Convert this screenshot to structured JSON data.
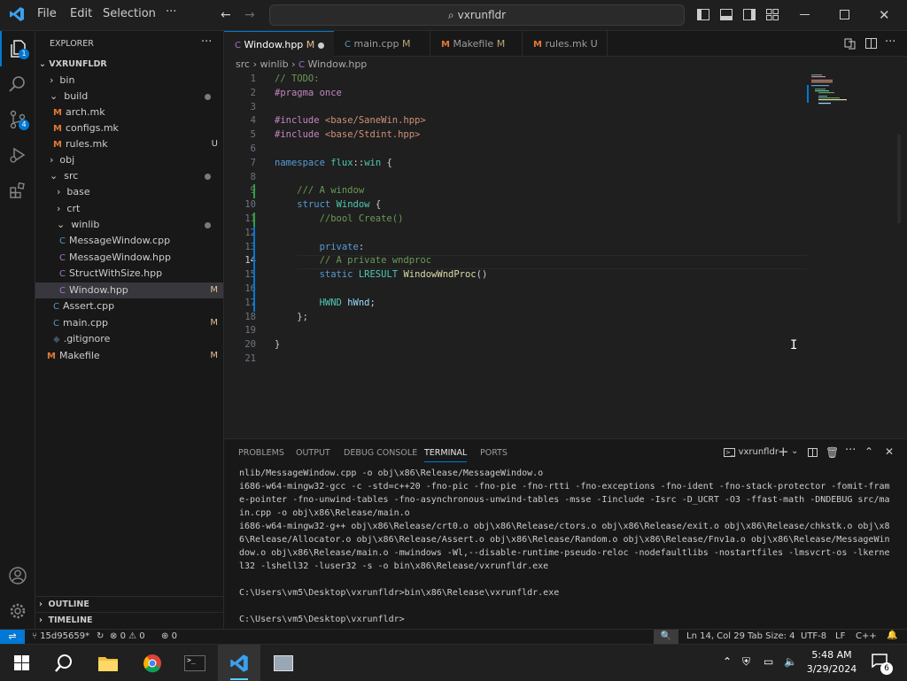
{
  "titlebar": {
    "menu": [
      "File",
      "Edit",
      "Selection",
      "···"
    ],
    "search_text": "vxrunfldr"
  },
  "activity": {
    "scm_badge": "4",
    "explorer_badge": "1"
  },
  "sidebar": {
    "header": "EXPLORER",
    "root": "VXRUNFLDR",
    "items": [
      {
        "label": "bin",
        "status": ""
      },
      {
        "label": "build",
        "status": ""
      },
      {
        "label": "arch.mk",
        "status": ""
      },
      {
        "label": "configs.mk",
        "status": ""
      },
      {
        "label": "rules.mk",
        "status": "U"
      },
      {
        "label": "obj",
        "status": ""
      },
      {
        "label": "src",
        "status": ""
      },
      {
        "label": "base",
        "status": ""
      },
      {
        "label": "crt",
        "status": ""
      },
      {
        "label": "winlib",
        "status": ""
      },
      {
        "label": "MessageWindow.cpp",
        "status": ""
      },
      {
        "label": "MessageWindow.hpp",
        "status": ""
      },
      {
        "label": "StructWithSize.hpp",
        "status": ""
      },
      {
        "label": "Window.hpp",
        "status": "M"
      },
      {
        "label": "Assert.cpp",
        "status": ""
      },
      {
        "label": "main.cpp",
        "status": "M"
      },
      {
        "label": ".gitignore",
        "status": ""
      },
      {
        "label": "Makefile",
        "status": "M"
      }
    ],
    "outline": "OUTLINE",
    "timeline": "TIMELINE"
  },
  "tabs": [
    {
      "label": "Window.hpp",
      "status": "M"
    },
    {
      "label": "main.cpp",
      "status": "M"
    },
    {
      "label": "Makefile",
      "status": "M"
    },
    {
      "label": "rules.mk",
      "status": "U"
    }
  ],
  "breadcrumb": [
    "src",
    "winlib",
    "Window.hpp"
  ],
  "editor": {
    "lines": [
      "// TODO:",
      "#pragma once",
      "",
      "#include <base/SaneWin.hpp>",
      "#include <base/Stdint.hpp>",
      "",
      "namespace flux::win {",
      "",
      "    /// A window",
      "    struct Window {",
      "        //bool Create()",
      "",
      "        private:",
      "        // A private wndproc",
      "        static LRESULT WindowWndProc()",
      "",
      "        HWND hWnd;",
      "    };",
      "",
      "}",
      ""
    ],
    "current_line": 14
  },
  "panel": {
    "tabs": [
      "PROBLEMS",
      "OUTPUT",
      "DEBUG CONSOLE",
      "TERMINAL",
      "PORTS"
    ],
    "active_tab": "TERMINAL",
    "terminal_name": "vxrunfldr",
    "terminal_lines": [
      "nlib/MessageWindow.cpp -o obj\\x86\\Release/MessageWindow.o",
      "i686-w64-mingw32-gcc -c -std=c++20 -fno-pic -fno-pie -fno-rtti -fno-exceptions -fno-ident -fno-stack-protector -fomit-fram",
      "e-pointer -fno-unwind-tables -fno-asynchronous-unwind-tables -msse -Iinclude -Isrc -D_UCRT -O3 -ffast-math -DNDEBUG src/ma",
      "in.cpp -o obj\\x86\\Release/main.o",
      "i686-w64-mingw32-g++ obj\\x86\\Release/crt0.o obj\\x86\\Release/ctors.o obj\\x86\\Release/exit.o obj\\x86\\Release/chkstk.o obj\\x8",
      "6\\Release/Allocator.o obj\\x86\\Release/Assert.o obj\\x86\\Release/Random.o obj\\x86\\Release/Fnv1a.o obj\\x86\\Release/MessageWin",
      "dow.o obj\\x86\\Release/main.o -mwindows -Wl,--disable-runtime-pseudo-reloc -nodefaultlibs -nostartfiles -lmsvcrt-os -lkerne",
      "l32 -lshell32 -luser32 -s -o bin\\x86\\Release/vxrunfldr.exe",
      "",
      "C:\\Users\\vm5\\Desktop\\vxrunfldr>bin\\x86\\Release\\vxrunfldr.exe",
      "",
      "C:\\Users\\vm5\\Desktop\\vxrunfldr>"
    ]
  },
  "statusbar": {
    "branch": "15d95659*",
    "errors": "0",
    "warnings": "0",
    "ports": "0",
    "position": "Ln 14, Col 29",
    "tab_size": "Tab Size: 4",
    "encoding": "UTF-8",
    "eol": "LF",
    "language": "C++"
  },
  "taskbar": {
    "time": "5:48 AM",
    "date": "3/29/2024",
    "notif_count": "6"
  }
}
